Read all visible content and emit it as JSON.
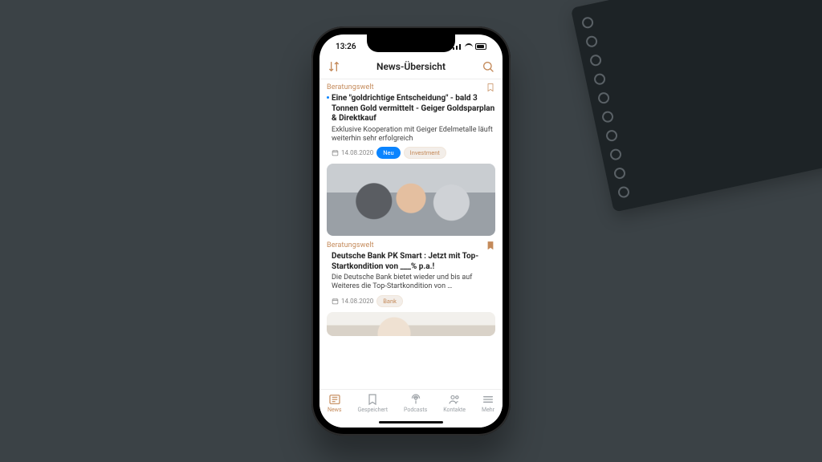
{
  "statusbar": {
    "time": "13:26"
  },
  "navbar": {
    "title": "News-Übersicht"
  },
  "icons": {
    "sort": "sort-icon",
    "search": "search-icon",
    "bookmark": "bookmark-icon",
    "calendar": "calendar-icon"
  },
  "articles": [
    {
      "category": "Beratungswelt",
      "headline": "Eine \"goldrichtige Entscheidung\" - bald 3 Tonnen Gold vermittelt - Geiger Goldsparplan & Direktkauf",
      "excerpt": "Exklusive Kooperation mit Geiger Edelmetalle läuft weiterhin sehr erfolgreich",
      "date": "14.08.2020",
      "unread": true,
      "bookmarked": false,
      "tags": [
        {
          "label": "Neu",
          "primary": true
        },
        {
          "label": "Investment",
          "primary": false
        }
      ]
    },
    {
      "category": "Beratungswelt",
      "headline": "Deutsche Bank PK Smart : Jetzt mit Top-Startkondition von ___% p.a.!",
      "excerpt": "Die Deutsche Bank bietet wieder und bis auf Weiteres die Top-Startkondition von …",
      "date": "14.08.2020",
      "unread": false,
      "bookmarked": true,
      "tags": [
        {
          "label": "Bank",
          "primary": false
        }
      ]
    }
  ],
  "tabs": [
    {
      "id": "news",
      "label": "News",
      "icon": "newspaper-icon",
      "active": true
    },
    {
      "id": "gespeichert",
      "label": "Gespeichert",
      "icon": "bookmark-icon",
      "active": false
    },
    {
      "id": "podcasts",
      "label": "Podcasts",
      "icon": "podcast-icon",
      "active": false
    },
    {
      "id": "kontakte",
      "label": "Kontakte",
      "icon": "contacts-icon",
      "active": false
    },
    {
      "id": "mehr",
      "label": "Mehr",
      "icon": "menu-icon",
      "active": false
    }
  ],
  "colors": {
    "accent": "#c48a5a",
    "primary": "#0a84ff",
    "bg": "#3b4246"
  }
}
